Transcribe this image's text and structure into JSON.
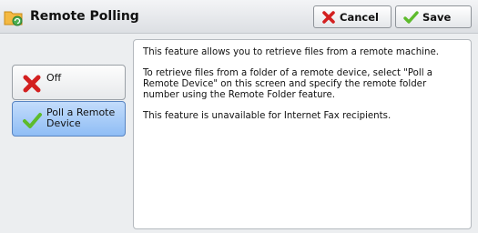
{
  "header": {
    "title": "Remote Polling",
    "title_icon": "folder-refresh-icon",
    "cancel_label": "Cancel",
    "save_label": "Save"
  },
  "options": [
    {
      "label": "Off",
      "icon": "red-x-icon",
      "selected": false
    },
    {
      "label": "Poll a Remote Device",
      "icon": "green-check-icon",
      "selected": true
    }
  ],
  "description": {
    "p1": "This feature allows you to retrieve files from a remote machine.",
    "p2": "To retrieve files from a folder of a remote device, select \"Poll a Remote Device\" on this screen and specify the remote folder number using the Remote Folder feature.",
    "p3": "This feature is unavailable for Internet Fax recipients."
  },
  "colors": {
    "selected_option": "#9fc6f7",
    "cancel_x": "#d32020",
    "check": "#5dbb2c",
    "folder": "#f4b942"
  }
}
